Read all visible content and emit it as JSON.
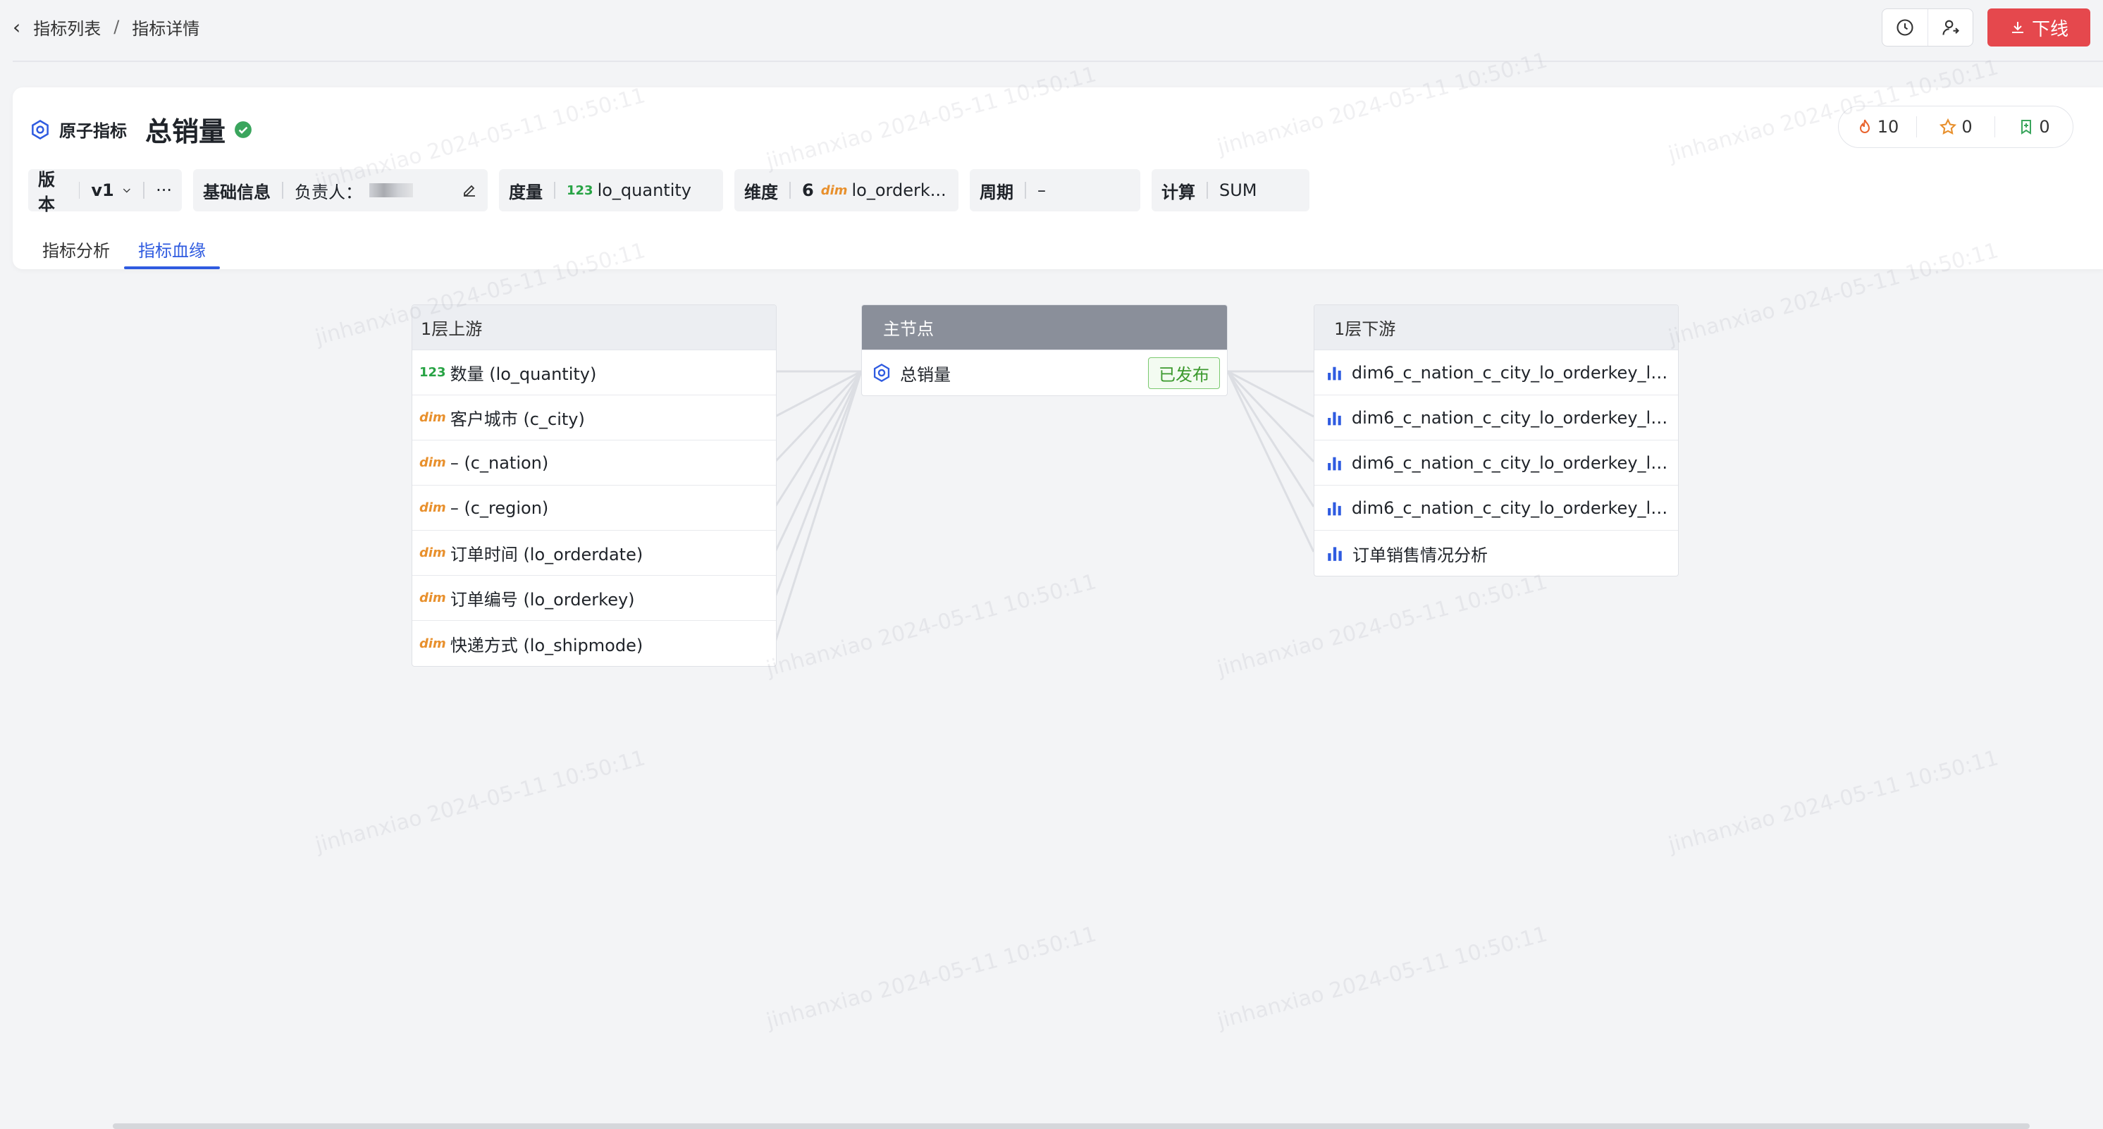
{
  "breadcrumb": {
    "parent": "指标列表",
    "separator": "/",
    "current": "指标详情"
  },
  "top_actions": {
    "offline_label": "下线"
  },
  "metric": {
    "type_label": "原子指标",
    "title": "总销量",
    "stats": {
      "hot": "10",
      "star": "0",
      "bookmark": "0"
    }
  },
  "info": {
    "version": {
      "key": "版本",
      "value": "v1",
      "more": "···"
    },
    "basic": {
      "key": "基础信息",
      "owner_label": "负责人："
    },
    "measure": {
      "key": "度量",
      "tag": "123",
      "value": "lo_quantity"
    },
    "dimension": {
      "key": "维度",
      "count": "6",
      "tag": "dim",
      "value": "lo_orderk..."
    },
    "period": {
      "key": "周期",
      "value": "–"
    },
    "calc": {
      "key": "计算",
      "value": "SUM"
    }
  },
  "tabs": [
    {
      "label": "指标分析",
      "active": false
    },
    {
      "label": "指标血缘",
      "active": true
    }
  ],
  "lineage": {
    "upstream": {
      "title": "1层上游",
      "items": [
        {
          "tag": "123",
          "label": "数量 (lo_quantity)"
        },
        {
          "tag": "dim",
          "label": "客户城市 (c_city)"
        },
        {
          "tag": "dim",
          "label": "– (c_nation)"
        },
        {
          "tag": "dim",
          "label": "– (c_region)"
        },
        {
          "tag": "dim",
          "label": "订单时间 (lo_orderdate)"
        },
        {
          "tag": "dim",
          "label": "订单编号 (lo_orderkey)"
        },
        {
          "tag": "dim",
          "label": "快递方式 (lo_shipmode)"
        }
      ]
    },
    "main": {
      "title": "主节点",
      "node_label": "总销量",
      "status": "已发布"
    },
    "downstream": {
      "title": "1层下游",
      "items": [
        {
          "label": "dim6_c_nation_c_city_lo_orderkey_lo_..."
        },
        {
          "label": "dim6_c_nation_c_city_lo_orderkey_lo_..."
        },
        {
          "label": "dim6_c_nation_c_city_lo_orderkey_lo_..."
        },
        {
          "label": "dim6_c_nation_c_city_lo_orderkey_lo_..."
        },
        {
          "label": "订单销售情况分析"
        }
      ]
    }
  },
  "watermark_text": "jinhanxiao 2024-05-11 10:50:11",
  "colors": {
    "primary": "#2f5be0",
    "danger": "#e5484d",
    "success": "#3c9a2e",
    "dim_tag": "#e8902d",
    "num_tag": "#27a344"
  }
}
